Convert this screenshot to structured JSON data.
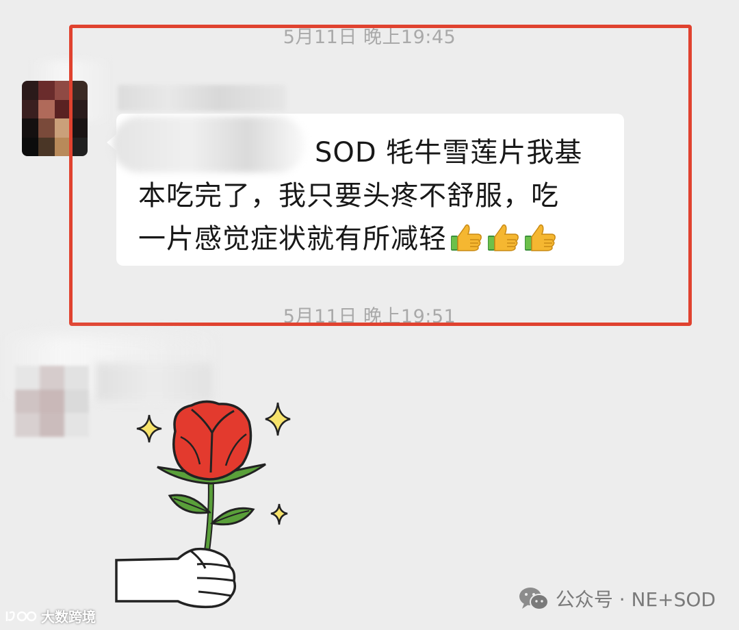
{
  "chat": {
    "timestamp_1": "5月11日 晚上19:45",
    "timestamp_2": "5月11日 晚上19:51",
    "message": {
      "line_1": "SOD 牦牛雪莲片我基",
      "line_2": "本吃完了，我只要头疼不舒服，吃",
      "line_3": "一片感觉症状就有所减轻",
      "emoji": [
        "thumbs-up-icon",
        "thumbs-up-icon",
        "thumbs-up-icon"
      ]
    },
    "sticker": "rose-sticker"
  },
  "watermark": {
    "label": "公众号 · NE+SOD",
    "icon": "wechat-icon"
  },
  "brand": {
    "label": "大数跨境"
  },
  "colors": {
    "background": "#ededed",
    "bubble": "#ffffff",
    "highlight": "#e0422f",
    "timestamp": "#a9a9a9"
  }
}
